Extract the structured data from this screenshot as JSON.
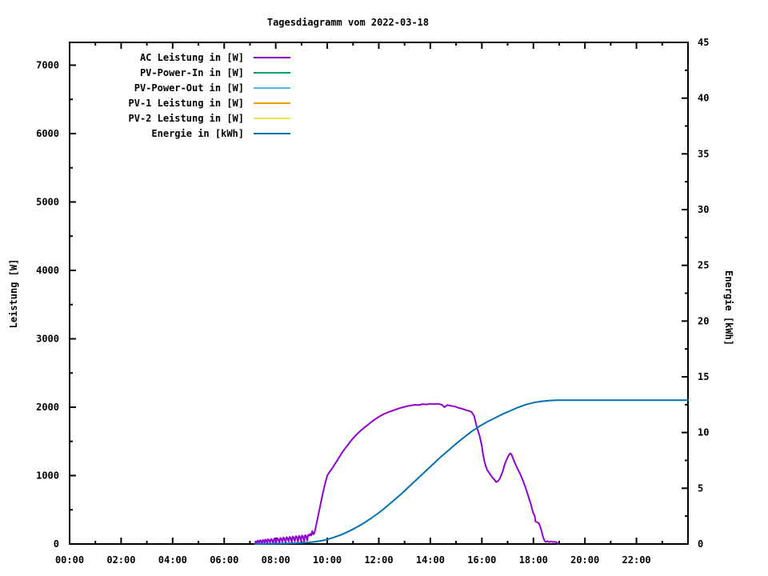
{
  "chart_data": {
    "type": "line",
    "title": "Tagesdiagramm vom 2022-03-18",
    "xlabel": "",
    "ylabel": "Leistung [W]",
    "y2label": "Energie [kWh]",
    "background_color": "#ffffff",
    "axis_color": "#000000",
    "grid": false,
    "legend_position": "top-left-inside",
    "x_range_hours": [
      0,
      24
    ],
    "y_range": [
      0,
      7333
    ],
    "y2_range": [
      0,
      45
    ],
    "x_tick_hours": [
      0,
      2,
      4,
      6,
      8,
      10,
      12,
      14,
      16,
      18,
      20,
      22
    ],
    "x_tick_labels": [
      "00:00",
      "02:00",
      "04:00",
      "06:00",
      "08:00",
      "10:00",
      "12:00",
      "14:00",
      "16:00",
      "18:00",
      "20:00",
      "22:00"
    ],
    "x_minor_step_hours": 1,
    "y_tick_values": [
      0,
      1000,
      2000,
      3000,
      4000,
      5000,
      6000,
      7000
    ],
    "y_tick_labels": [
      "0",
      "1000",
      "2000",
      "3000",
      "4000",
      "5000",
      "6000",
      "7000"
    ],
    "y_minor_step": 500,
    "y2_tick_values": [
      0,
      5,
      10,
      15,
      20,
      25,
      30,
      35,
      40,
      45
    ],
    "y2_tick_labels": [
      "0",
      "5",
      "10",
      "15",
      "20",
      "25",
      "30",
      "35",
      "40",
      "45"
    ],
    "y2_minor_step": 2.5,
    "series": [
      {
        "name": "AC Leistung in [W]",
        "color": "#9400D3",
        "axis": "y1",
        "points": [
          [
            7.2,
            0
          ],
          [
            7.22,
            40
          ],
          [
            7.25,
            35
          ],
          [
            7.27,
            5
          ],
          [
            7.3,
            50
          ],
          [
            7.33,
            45
          ],
          [
            7.36,
            10
          ],
          [
            7.4,
            55
          ],
          [
            7.44,
            40
          ],
          [
            7.47,
            0
          ],
          [
            7.5,
            60
          ],
          [
            7.54,
            50
          ],
          [
            7.57,
            15
          ],
          [
            7.6,
            65
          ],
          [
            7.64,
            55
          ],
          [
            7.67,
            5
          ],
          [
            7.7,
            70
          ],
          [
            7.74,
            60
          ],
          [
            7.78,
            20
          ],
          [
            7.82,
            75
          ],
          [
            7.86,
            60
          ],
          [
            7.9,
            10
          ],
          [
            7.94,
            80
          ],
          [
            7.98,
            65
          ],
          [
            8.02,
            25
          ],
          [
            8.06,
            85
          ],
          [
            8.1,
            70
          ],
          [
            8.14,
            15
          ],
          [
            8.18,
            90
          ],
          [
            8.22,
            75
          ],
          [
            8.26,
            30
          ],
          [
            8.3,
            95
          ],
          [
            8.34,
            80
          ],
          [
            8.38,
            20
          ],
          [
            8.42,
            100
          ],
          [
            8.46,
            85
          ],
          [
            8.5,
            35
          ],
          [
            8.54,
            105
          ],
          [
            8.58,
            90
          ],
          [
            8.62,
            25
          ],
          [
            8.66,
            110
          ],
          [
            8.7,
            95
          ],
          [
            8.74,
            40
          ],
          [
            8.78,
            115
          ],
          [
            8.82,
            100
          ],
          [
            8.86,
            30
          ],
          [
            8.9,
            120
          ],
          [
            8.94,
            105
          ],
          [
            8.98,
            45
          ],
          [
            9.02,
            125
          ],
          [
            9.06,
            110
          ],
          [
            9.1,
            35
          ],
          [
            9.14,
            130
          ],
          [
            9.18,
            115
          ],
          [
            9.22,
            50
          ],
          [
            9.26,
            135
          ],
          [
            9.3,
            120
          ],
          [
            9.34,
            150
          ],
          [
            9.38,
            125
          ],
          [
            9.42,
            190
          ],
          [
            9.46,
            140
          ],
          [
            9.5,
            160
          ],
          [
            9.55,
            240
          ],
          [
            9.6,
            330
          ],
          [
            9.65,
            420
          ],
          [
            9.7,
            510
          ],
          [
            9.75,
            600
          ],
          [
            9.8,
            690
          ],
          [
            9.85,
            780
          ],
          [
            9.9,
            860
          ],
          [
            9.95,
            930
          ],
          [
            10.0,
            1000
          ],
          [
            10.1,
            1060
          ],
          [
            10.2,
            1110
          ],
          [
            10.3,
            1170
          ],
          [
            10.4,
            1230
          ],
          [
            10.5,
            1290
          ],
          [
            10.6,
            1350
          ],
          [
            10.7,
            1400
          ],
          [
            10.8,
            1450
          ],
          [
            10.9,
            1500
          ],
          [
            11.0,
            1545
          ],
          [
            11.15,
            1605
          ],
          [
            11.3,
            1660
          ],
          [
            11.45,
            1705
          ],
          [
            11.6,
            1750
          ],
          [
            11.75,
            1795
          ],
          [
            11.9,
            1835
          ],
          [
            12.05,
            1870
          ],
          [
            12.2,
            1900
          ],
          [
            12.35,
            1925
          ],
          [
            12.5,
            1945
          ],
          [
            12.65,
            1965
          ],
          [
            12.8,
            1985
          ],
          [
            12.95,
            2000
          ],
          [
            13.1,
            2015
          ],
          [
            13.25,
            2025
          ],
          [
            13.4,
            2035
          ],
          [
            13.55,
            2030
          ],
          [
            13.7,
            2045
          ],
          [
            13.85,
            2040
          ],
          [
            14.0,
            2050
          ],
          [
            14.15,
            2045
          ],
          [
            14.3,
            2050
          ],
          [
            14.45,
            2035
          ],
          [
            14.55,
            2000
          ],
          [
            14.65,
            2030
          ],
          [
            14.8,
            2020
          ],
          [
            14.95,
            2010
          ],
          [
            15.1,
            1990
          ],
          [
            15.25,
            1975
          ],
          [
            15.4,
            1955
          ],
          [
            15.5,
            1945
          ],
          [
            15.6,
            1930
          ],
          [
            15.65,
            1900
          ],
          [
            15.7,
            1870
          ],
          [
            15.75,
            1790
          ],
          [
            15.8,
            1715
          ],
          [
            15.85,
            1655
          ],
          [
            15.9,
            1600
          ],
          [
            15.95,
            1520
          ],
          [
            16.0,
            1435
          ],
          [
            16.05,
            1300
          ],
          [
            16.1,
            1205
          ],
          [
            16.15,
            1140
          ],
          [
            16.2,
            1085
          ],
          [
            16.3,
            1030
          ],
          [
            16.4,
            975
          ],
          [
            16.5,
            935
          ],
          [
            16.55,
            905
          ],
          [
            16.6,
            915
          ],
          [
            16.65,
            930
          ],
          [
            16.7,
            960
          ],
          [
            16.8,
            1050
          ],
          [
            16.9,
            1180
          ],
          [
            17.0,
            1265
          ],
          [
            17.05,
            1300
          ],
          [
            17.1,
            1325
          ],
          [
            17.15,
            1310
          ],
          [
            17.2,
            1260
          ],
          [
            17.3,
            1170
          ],
          [
            17.4,
            1090
          ],
          [
            17.5,
            1015
          ],
          [
            17.6,
            920
          ],
          [
            17.7,
            820
          ],
          [
            17.8,
            700
          ],
          [
            17.9,
            585
          ],
          [
            17.95,
            510
          ],
          [
            18.0,
            445
          ],
          [
            18.05,
            410
          ],
          [
            18.08,
            330
          ],
          [
            18.15,
            318
          ],
          [
            18.22,
            300
          ],
          [
            18.28,
            235
          ],
          [
            18.33,
            170
          ],
          [
            18.38,
            95
          ],
          [
            18.43,
            50
          ],
          [
            18.48,
            30
          ],
          [
            18.55,
            42
          ],
          [
            18.6,
            28
          ],
          [
            18.68,
            38
          ],
          [
            18.75,
            30
          ],
          [
            18.85,
            32
          ],
          [
            18.92,
            20
          ],
          [
            18.96,
            0
          ]
        ]
      },
      {
        "name": "PV-Power-In in [W]",
        "color": "#009E73",
        "axis": "y1",
        "points": []
      },
      {
        "name": "PV-Power-Out in [W]",
        "color": "#56B4E9",
        "axis": "y1",
        "points": []
      },
      {
        "name": "PV-1 Leistung in [W]",
        "color": "#E69F00",
        "axis": "y1",
        "points": []
      },
      {
        "name": "PV-2 Leistung in [W]",
        "color": "#F0E442",
        "axis": "y1",
        "points": []
      },
      {
        "name": "Energie in [kWh]",
        "color": "#0072B2",
        "axis": "y2",
        "points": [
          [
            7.2,
            0
          ],
          [
            8.0,
            0.03
          ],
          [
            8.5,
            0.06
          ],
          [
            9.0,
            0.1
          ],
          [
            9.3,
            0.14
          ],
          [
            9.6,
            0.22
          ],
          [
            9.9,
            0.35
          ],
          [
            10.2,
            0.55
          ],
          [
            10.5,
            0.8
          ],
          [
            10.8,
            1.1
          ],
          [
            11.1,
            1.45
          ],
          [
            11.4,
            1.85
          ],
          [
            11.7,
            2.3
          ],
          [
            12.0,
            2.8
          ],
          [
            12.3,
            3.35
          ],
          [
            12.6,
            3.95
          ],
          [
            12.9,
            4.55
          ],
          [
            13.2,
            5.2
          ],
          [
            13.5,
            5.85
          ],
          [
            13.8,
            6.5
          ],
          [
            14.1,
            7.15
          ],
          [
            14.4,
            7.8
          ],
          [
            14.7,
            8.4
          ],
          [
            15.0,
            9.0
          ],
          [
            15.3,
            9.55
          ],
          [
            15.6,
            10.1
          ],
          [
            15.9,
            10.55
          ],
          [
            16.2,
            10.95
          ],
          [
            16.5,
            11.3
          ],
          [
            16.8,
            11.65
          ],
          [
            17.1,
            11.95
          ],
          [
            17.4,
            12.25
          ],
          [
            17.7,
            12.5
          ],
          [
            18.0,
            12.68
          ],
          [
            18.3,
            12.8
          ],
          [
            18.6,
            12.87
          ],
          [
            18.9,
            12.9
          ],
          [
            19.2,
            12.9
          ],
          [
            20.0,
            12.9
          ],
          [
            22.0,
            12.9
          ],
          [
            24.0,
            12.9
          ]
        ]
      }
    ]
  }
}
